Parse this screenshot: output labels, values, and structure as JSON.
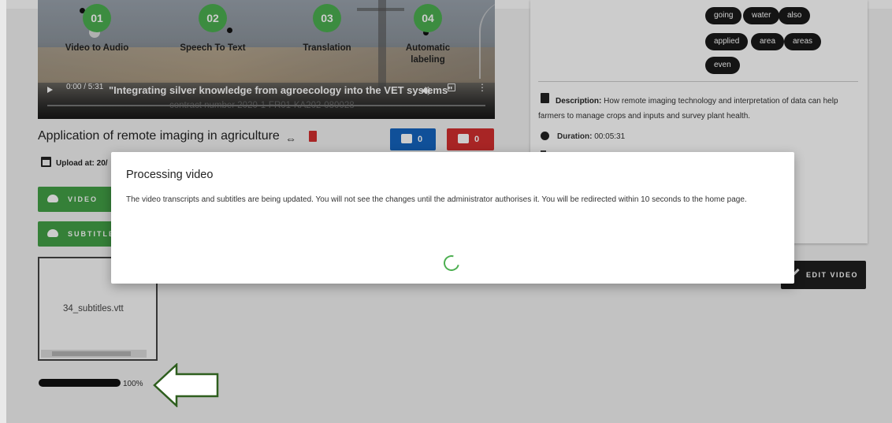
{
  "player": {
    "steps": [
      {
        "num": "01",
        "label": "Video to Audio"
      },
      {
        "num": "02",
        "label": "Speech To Text"
      },
      {
        "num": "03",
        "label": "Translation"
      },
      {
        "num": "04",
        "label": "Automatic labeling"
      }
    ],
    "time": "0:00 / 5:31",
    "caption_line1": "\"Integrating silver knowledge from agroecology into the VET systems\"",
    "caption_line2": "contract number 2020-1-FR01-KA202-080028"
  },
  "video": {
    "title": "Application of remote imaging in agriculture",
    "likes": "0",
    "dislikes": "0",
    "upload_label": "Upload at: 20/"
  },
  "buttons": {
    "video": "VIDEO",
    "subtitles": "SUBTITLE",
    "edit_video": "EDIT VIDEO"
  },
  "file": {
    "name": "34_subtitles.vtt",
    "upload_progress": "100%",
    "upload_fraction": 1.0
  },
  "tags": [
    "going",
    "water",
    "also",
    "applied",
    "area",
    "areas",
    "even"
  ],
  "details": {
    "description_label": "Description:",
    "description": " How remote imaging technology and interpretation of data can help farmers to manage crops and inputs and survey plant health.",
    "duration_label": "Duration:",
    "duration": " 00:05:31"
  },
  "modal": {
    "title": "Processing video",
    "body": "The video transcripts and subtitles are being updated. You will not see the changes until the administrator authorises it. You will be redirected within 10 seconds to the home page."
  },
  "colors": {
    "accent_green": "#43a047",
    "like_blue": "#1565c0",
    "dislike_red": "#d32f2f",
    "tag_dark": "#1a1a1a"
  }
}
